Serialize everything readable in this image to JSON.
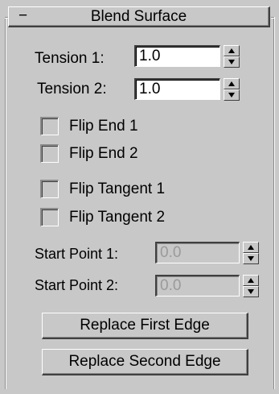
{
  "rollout": {
    "toggle": "−",
    "title": "Blend Surface"
  },
  "tension": [
    {
      "label": "Tension 1:",
      "value": "1.0"
    },
    {
      "label": "Tension 2:",
      "value": "1.0"
    }
  ],
  "checkboxes": [
    {
      "label": "Flip End 1",
      "checked": false
    },
    {
      "label": "Flip End 2",
      "checked": false
    },
    {
      "label": "Flip Tangent 1",
      "checked": false
    },
    {
      "label": "Flip Tangent 2",
      "checked": false
    }
  ],
  "start_points": [
    {
      "label": "Start Point 1:",
      "value": "0.0",
      "enabled": false
    },
    {
      "label": "Start Point 2:",
      "value": "0.0",
      "enabled": false
    }
  ],
  "buttons": {
    "replace_first": "Replace First Edge",
    "replace_second": "Replace Second Edge"
  },
  "icons": {
    "spinner_up": "triangle-up-icon",
    "spinner_down": "triangle-down-icon"
  }
}
